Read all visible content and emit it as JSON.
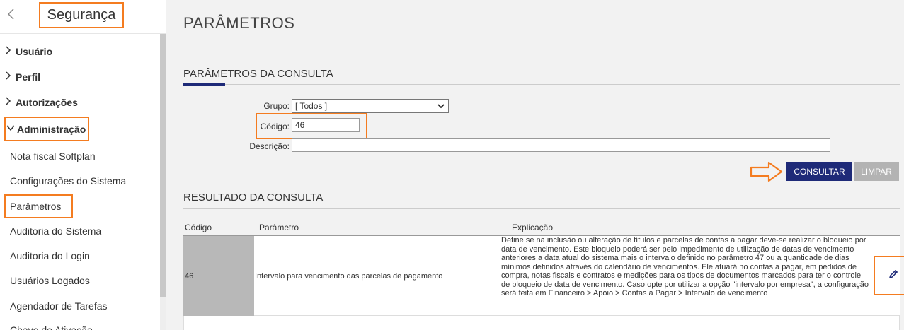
{
  "sidebar": {
    "title": "Segurança",
    "groups": [
      {
        "label": "Usuário",
        "chevron": "›"
      },
      {
        "label": "Perfil",
        "chevron": "›"
      },
      {
        "label": "Autorizações",
        "chevron": "›"
      },
      {
        "label": "Administração",
        "chevron": "⌄"
      }
    ],
    "items": [
      {
        "label": "Nota fiscal Softplan"
      },
      {
        "label": "Configurações do Sistema"
      },
      {
        "label": "Parâmetros"
      },
      {
        "label": "Auditoria do Sistema"
      },
      {
        "label": "Auditoria do Login"
      },
      {
        "label": "Usuários Logados"
      },
      {
        "label": "Agendador de Tarefas"
      },
      {
        "label": "Chave de Ativação"
      }
    ]
  },
  "main": {
    "page_title": "PARÂMETROS",
    "query_section_title": "PARÂMETROS DA CONSULTA",
    "form": {
      "grupo_label": "Grupo:",
      "grupo_value": "[ Todos ]",
      "codigo_label": "Código:",
      "codigo_value": "46",
      "descricao_label": "Descrição:",
      "descricao_value": ""
    },
    "buttons": {
      "consultar": "CONSULTAR",
      "limpar": "LIMPAR"
    },
    "results_section_title": "RESULTADO DA CONSULTA",
    "table": {
      "headers": [
        "Código",
        "Parâmetro",
        "Explicação"
      ],
      "rows": [
        {
          "codigo": "46",
          "parametro": "Intervalo para vencimento das parcelas de pagamento",
          "explicacao": "Define se na inclusão ou alteração de títulos e parcelas de contas a pagar deve-se realizar o bloqueio por data de vencimento. Este bloqueio poderá ser pelo impedimento de utilização de datas de vencimento anteriores a data atual do sistema mais o intervalo definido no parâmetro 47 ou a quantidade de dias mínimos definidos através do calendário de vencimentos. Ele atuará no contas a pagar, em pedidos de compra, notas fiscais e contratos e medições para os tipos de documentos marcados para ter o controle de bloqueio de data de vencimento. Caso opte por utilizar a opção \"intervalo por empresa\", a configuração será feita em Financeiro > Apoio > Contas a Pagar > Intervalo de vencimento",
          "action_icon": "pencil-icon"
        }
      ]
    }
  },
  "colors": {
    "accent": "#1e2a78",
    "highlight": "#f47c20",
    "secondary_button": "#b3b3b3"
  }
}
